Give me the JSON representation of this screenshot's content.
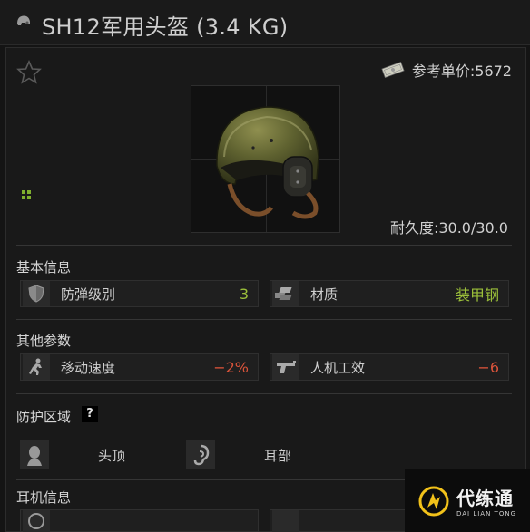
{
  "header": {
    "title": "SH12军用头盔 (3.4 KG)",
    "icon": "helmet-icon"
  },
  "item": {
    "price_text": "参考单价:5672",
    "durability_text": "耐久度:30.0/30.0"
  },
  "sections": {
    "basic": {
      "title": "基本信息",
      "stats": [
        {
          "label": "防弹级别",
          "value": "3",
          "color": "#9bbf3a",
          "icon": "armor-class-icon"
        },
        {
          "label": "材质",
          "value": "装甲钢",
          "color": "#9bbf3a",
          "icon": "material-icon"
        }
      ]
    },
    "other": {
      "title": "其他参数",
      "stats": [
        {
          "label": "移动速度",
          "value": "−2%",
          "color": "#d9533a",
          "icon": "movement-speed-icon"
        },
        {
          "label": "人机工效",
          "value": "−6",
          "color": "#d9533a",
          "icon": "ergonomics-icon"
        }
      ]
    },
    "protection": {
      "title": "防护区域",
      "help": "?",
      "zones": [
        {
          "label": "头顶",
          "icon": "head-top-icon"
        },
        {
          "label": "耳部",
          "icon": "ear-icon"
        }
      ]
    },
    "headset": {
      "title": "耳机信息"
    }
  },
  "watermark": {
    "cn": "代练通",
    "en": "DAI LIAN TONG"
  },
  "colors": {
    "positive": "#9bbf3a",
    "negative": "#d9533a",
    "background": "#141414"
  }
}
